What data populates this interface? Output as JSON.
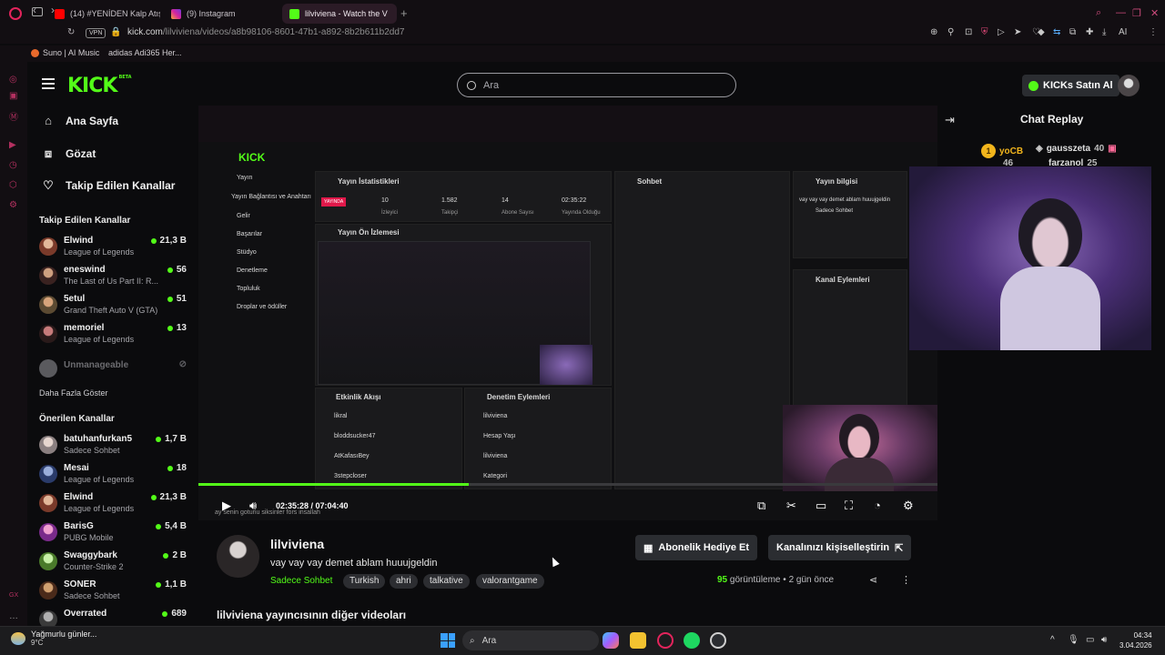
{
  "browser": {
    "tabs": [
      {
        "title": "(14) #YENİDEN Kalp Atışı ||",
        "favicon_color": "#ff0000"
      },
      {
        "title": "(9) Instagram",
        "favicon_color": "#d6249f"
      },
      {
        "title": "lilviviena - Watch the V",
        "favicon_color": "#53fc18"
      }
    ],
    "url_host": "kick.com",
    "url_path": "/lilviviena/videos/a8b98106-8601-47b1-a892-8b2b611b2dd7",
    "vpn_label": "VPN",
    "ai_label": "AI",
    "bookmarks": [
      "Suno | AI Music",
      "adidas Adi365 Her..."
    ]
  },
  "header": {
    "logo": "KICK",
    "logo_sup": "BETA",
    "search_placeholder": "Ara",
    "kicks_button": "KICKs Satın Al"
  },
  "nav": {
    "home": "Ana Sayfa",
    "browse": "Gözat",
    "following": "Takip Edilen Kanallar"
  },
  "followed": {
    "title": "Takip Edilen Kanallar",
    "channels": [
      {
        "name": "Elwind",
        "category": "League of Legends",
        "viewers": "21,3 B"
      },
      {
        "name": "eneswind",
        "category": "The Last of Us Part II: R...",
        "viewers": "56"
      },
      {
        "name": "5etul",
        "category": "Grand Theft Auto V (GTA)",
        "viewers": "51"
      },
      {
        "name": "memoriel",
        "category": "League of Legends",
        "viewers": "13"
      }
    ],
    "unmanageable": "Unmanageable",
    "show_more": "Daha Fazla Göster"
  },
  "recommended": {
    "title": "Önerilen Kanallar",
    "channels": [
      {
        "name": "batuhanfurkan5",
        "category": "Sadece Sohbet",
        "viewers": "1,7 B"
      },
      {
        "name": "Mesai",
        "category": "League of Legends",
        "viewers": "18"
      },
      {
        "name": "Elwind",
        "category": "League of Legends",
        "viewers": "21,3 B"
      },
      {
        "name": "BarisG",
        "category": "PUBG Mobile",
        "viewers": "5,4 B"
      },
      {
        "name": "Swaggybark",
        "category": "Counter-Strike 2",
        "viewers": "2 B"
      },
      {
        "name": "SONER",
        "category": "Sadece Sohbet",
        "viewers": "1,1 B"
      },
      {
        "name": "Overrated",
        "category": "",
        "viewers": "689"
      }
    ]
  },
  "video": {
    "time": "02:35:28 / 07:04:40",
    "progress": 0.366,
    "inner": {
      "dashboard_title": "Yayın İstatistikleri",
      "preview_title": "Yayın Ön İzlemesi",
      "chat_title": "Sohbet",
      "info_title": "Yayın bilgisi",
      "actions_title": "Kanal Eylemleri",
      "activity_title": "Etkinlik Akışı",
      "mod_title": "Denetim Eylemleri",
      "menu": [
        "Yayın",
        "Yayın Bağlantısı ve Anahtarı",
        "Gelir",
        "Başarılar",
        "Stüdyo",
        "Denetleme",
        "Topluluk",
        "Droplar ve ödüller"
      ],
      "stats": [
        "10",
        "1.582",
        "14",
        "02:35:22"
      ],
      "stat_labels": [
        "İzleyici",
        "Takipçi",
        "Abone Sayısı",
        "Yayında Olduğu"
      ],
      "live_badge": "YAYINDA",
      "info_text": "vay vay vay demet ablam huuujgeldin",
      "info_cat": "Sadece Sohbet",
      "activity": [
        "likral",
        "bloddsucker47",
        "AtKafasıBey",
        "3stepcloser"
      ],
      "mod": [
        "lilviviena",
        "Hesap Yaşı",
        "lilviviena",
        "Kategori"
      ],
      "caption": "ay senin gotunu siksinler fors insallah"
    }
  },
  "chat": {
    "title": "Chat Replay",
    "gifters": [
      {
        "name": "yoCB",
        "count": "46"
      },
      {
        "name": "gausszeta",
        "count": "40"
      },
      {
        "name": "farzanol",
        "count": "25"
      }
    ]
  },
  "stream": {
    "streamer": "lilviviena",
    "title": "vay vay vay demet ablam huuujgeldin",
    "category": "Sadece Sohbet",
    "tags": [
      "Turkish",
      "ahri",
      "talkative",
      "valorantgame"
    ],
    "gift_button": "Abonelik Hediye Et",
    "customize_button": "Kanalınızı kişiselleştirin",
    "views": "95",
    "views_label": "görüntüleme",
    "age": "2 gün önce",
    "other_videos": "lilviviena yayıncısının diğer videoları"
  },
  "taskbar": {
    "weather_title": "Yağmurlu günler...",
    "weather_temp": "9°C",
    "search": "Ara",
    "time": "04:34",
    "date": "3.04.2026"
  }
}
